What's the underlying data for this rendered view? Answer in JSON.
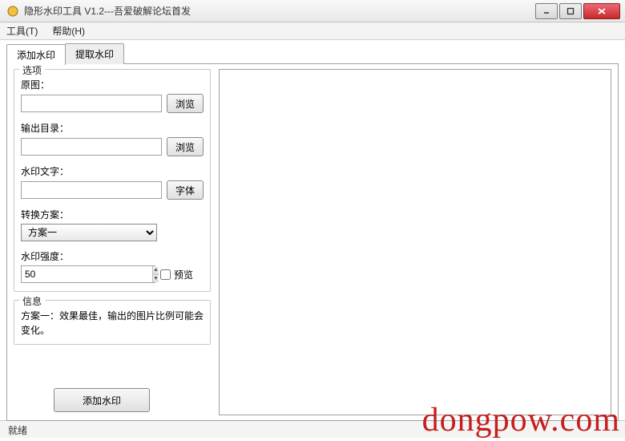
{
  "window": {
    "title": "隐形水印工具 V1.2---吾爱破解论坛首发"
  },
  "menu": {
    "tools": "工具(T)",
    "help": "帮助(H)"
  },
  "tabs": {
    "add": "添加水印",
    "extract": "提取水印"
  },
  "options": {
    "group_title": "选项",
    "source_label": "原图：",
    "source_value": "",
    "browse1": "浏览",
    "output_label": "输出目录：",
    "output_value": "",
    "browse2": "浏览",
    "text_label": "水印文字：",
    "text_value": "",
    "font_btn": "字体",
    "scheme_label": "转换方案：",
    "scheme_value": "方案一",
    "strength_label": "水印强度：",
    "strength_value": "50",
    "preview_chk": "预览"
  },
  "info": {
    "group_title": "信息",
    "text": "方案一：效果最佳，输出的图片比例可能会变化。"
  },
  "actions": {
    "add_watermark": "添加水印"
  },
  "status": {
    "text": "就绪"
  },
  "overlay": {
    "text": "dongpow.com"
  }
}
